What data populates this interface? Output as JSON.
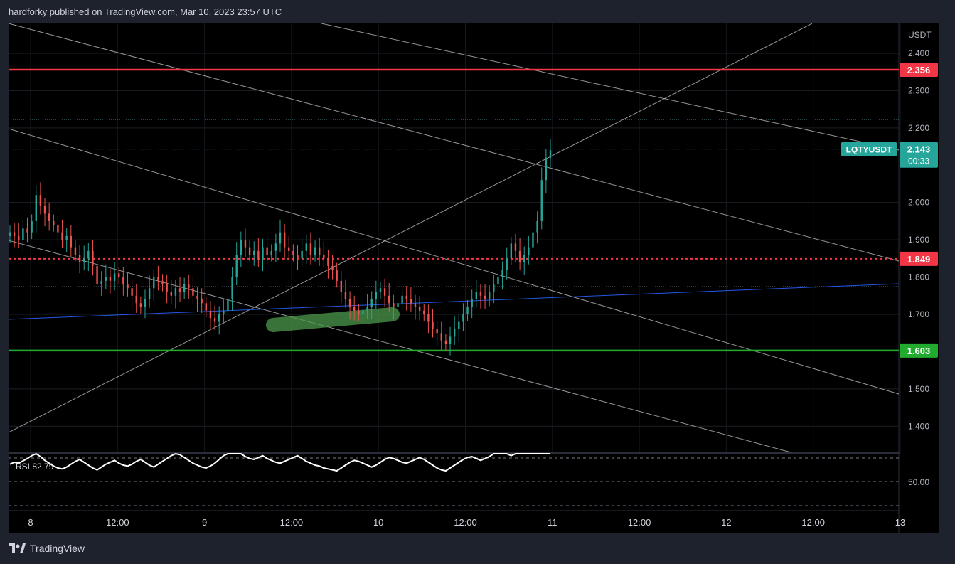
{
  "header": {
    "publisher": "hardforky published on TradingView.com, Mar 10, 2023 23:57 UTC"
  },
  "footer": {
    "brand": "TradingView"
  },
  "colors": {
    "background": "#000000",
    "frame": "#1e222d",
    "up": "#26a69a",
    "down": "#ef5350",
    "resistance": "#f23645",
    "support": "#22ab2e",
    "trend": "#2962ff",
    "channel": "#c8c8c8",
    "highlight": "#4c9a4c"
  },
  "chart_data": {
    "type": "candlestick",
    "symbol": "LQTYUSDT",
    "currency_label": "USDT",
    "y_ticks": [
      "2.400",
      "2.300",
      "2.200",
      "2.000",
      "1.900",
      "1.800",
      "1.700",
      "1.500",
      "1.400"
    ],
    "x_ticks": [
      "8",
      "12:00",
      "9",
      "12:00",
      "10",
      "12:00",
      "11",
      "12:00",
      "12",
      "12:00",
      "13"
    ],
    "ylim": [
      1.33,
      2.48
    ],
    "horizontal_levels": [
      {
        "label": "2.356",
        "value": 2.356,
        "style": "solid",
        "color": "#f23645"
      },
      {
        "label": "1.849",
        "value": 1.849,
        "style": "dotted",
        "color": "#f23645"
      },
      {
        "label": "1.603",
        "value": 1.603,
        "style": "solid",
        "color": "#22ab2e"
      }
    ],
    "last_price": {
      "label": "LQTYUSDT",
      "value": "2.143",
      "countdown": "00:33"
    },
    "ohlc_close_series": [
      1.92,
      1.91,
      1.9,
      1.93,
      1.92,
      1.95,
      2.02,
      1.99,
      1.97,
      1.95,
      1.94,
      1.92,
      1.9,
      1.91,
      1.88,
      1.86,
      1.84,
      1.85,
      1.87,
      1.83,
      1.78,
      1.79,
      1.8,
      1.79,
      1.81,
      1.8,
      1.78,
      1.77,
      1.75,
      1.73,
      1.72,
      1.74,
      1.77,
      1.8,
      1.79,
      1.78,
      1.76,
      1.75,
      1.77,
      1.76,
      1.78,
      1.77,
      1.75,
      1.74,
      1.73,
      1.71,
      1.69,
      1.68,
      1.7,
      1.71,
      1.74,
      1.8,
      1.86,
      1.9,
      1.88,
      1.86,
      1.87,
      1.85,
      1.88,
      1.86,
      1.87,
      1.89,
      1.92,
      1.88,
      1.87,
      1.86,
      1.85,
      1.87,
      1.89,
      1.86,
      1.88,
      1.86,
      1.85,
      1.83,
      1.82,
      1.79,
      1.76,
      1.74,
      1.72,
      1.71,
      1.7,
      1.71,
      1.72,
      1.74,
      1.76,
      1.77,
      1.75,
      1.73,
      1.72,
      1.73,
      1.75,
      1.74,
      1.73,
      1.72,
      1.71,
      1.7,
      1.68,
      1.66,
      1.65,
      1.63,
      1.62,
      1.64,
      1.66,
      1.68,
      1.7,
      1.72,
      1.74,
      1.76,
      1.75,
      1.74,
      1.76,
      1.78,
      1.8,
      1.82,
      1.85,
      1.89,
      1.87,
      1.84,
      1.86,
      1.88,
      1.92,
      1.95,
      2.06,
      2.12,
      2.14
    ],
    "rsi": {
      "label": "RSI",
      "value": "82.79",
      "y_tick": "50.00",
      "series": [
        48,
        52,
        50,
        55,
        60,
        66,
        70,
        64,
        56,
        50,
        44,
        40,
        38,
        42,
        48,
        54,
        58,
        52,
        46,
        40,
        36,
        42,
        48,
        52,
        56,
        50,
        46,
        44,
        48,
        54,
        58,
        52,
        46,
        42,
        48,
        54,
        60,
        66,
        70,
        68,
        62,
        56,
        50,
        46,
        42,
        40,
        44,
        50,
        58,
        66,
        74,
        80,
        76,
        70,
        64,
        60,
        58,
        62,
        66,
        60,
        56,
        52,
        50,
        54,
        58,
        62,
        66,
        60,
        54,
        50,
        46,
        44,
        40,
        38,
        36,
        34,
        40,
        46,
        52,
        56,
        54,
        50,
        46,
        42,
        46,
        52,
        58,
        62,
        60,
        56,
        52,
        50,
        54,
        58,
        62,
        58,
        52,
        46,
        40,
        36,
        34,
        40,
        46,
        52,
        58,
        62,
        64,
        60,
        56,
        60,
        64,
        70,
        76,
        80,
        72,
        66,
        70,
        74,
        80,
        86,
        90,
        86,
        80,
        82,
        84
      ]
    }
  }
}
